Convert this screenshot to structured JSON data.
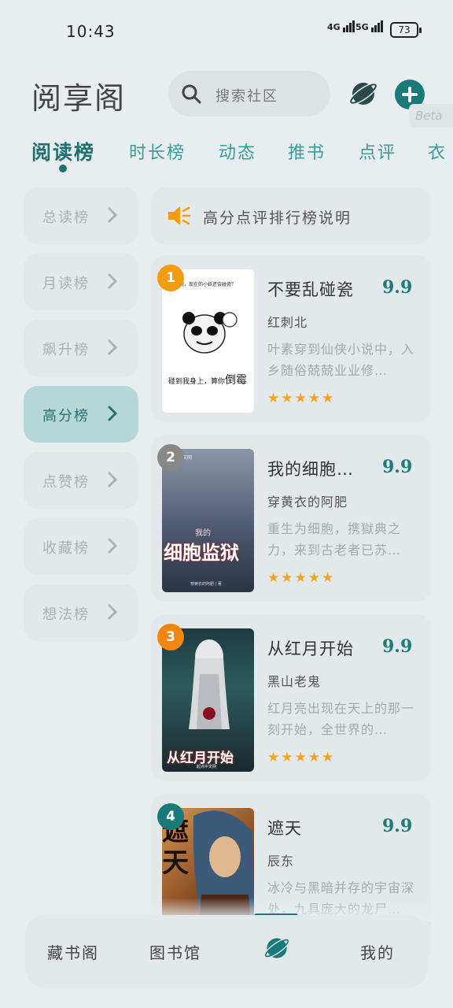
{
  "status_bar": {
    "time": "10:43",
    "net1": "4G",
    "net2": "5G",
    "battery": "73"
  },
  "header": {
    "title": "阅享阁",
    "search_placeholder": "搜索社区",
    "beta": "Beta"
  },
  "tabs": [
    "阅读榜",
    "时长榜",
    "动态",
    "推书",
    "点评",
    "衣"
  ],
  "sidebar": [
    {
      "label": "总读榜"
    },
    {
      "label": "月读榜"
    },
    {
      "label": "飙升榜"
    },
    {
      "label": "高分榜"
    },
    {
      "label": "点赞榜"
    },
    {
      "label": "收藏榜"
    },
    {
      "label": "想法榜"
    }
  ],
  "notice": "高分点评排行榜说明",
  "books": [
    {
      "rank": "1",
      "title": "不要乱碰瓷",
      "score": "9.9",
      "author": "红刺北",
      "desc": "叶素穿到仙侠小说中，入乡随俗兢兢业业修…",
      "cover_top": "这么多晚，现在的小妖还会碰瓷？",
      "cover_bottom1": "碰到我身上，算你",
      "cover_bottom2": "倒霉"
    },
    {
      "rank": "2",
      "title": "我的细胞…",
      "score": "9.9",
      "author": "穿黄衣的阿肥",
      "desc": "重生为细胞，携獄典之力，来到古老者已苏…",
      "cover_top": "起点中文网",
      "cover_mid": "我的",
      "cover_main": "细胞监狱",
      "cover_bottom": "穿黄衣的阿肥 | 著"
    },
    {
      "rank": "3",
      "title": "从红月开始",
      "score": "9.9",
      "author": "黑山老鬼",
      "desc": "红月亮出现在天上的那一刻开始，全世界的…",
      "cover_main": "从红月开始",
      "cover_bottom": "起点中文网"
    },
    {
      "rank": "4",
      "title": "遮天",
      "score": "9.9",
      "author": "辰东",
      "desc": "冰冷与黑暗并存的宇宙深处，九具庞大的龙尸…",
      "cover_main": "遮天"
    }
  ],
  "stars": "★★★★★",
  "bottom_nav": {
    "item1": "藏书阁",
    "item2": "图书馆",
    "item4": "我的"
  },
  "colors": {
    "accent": "#1f7a7a",
    "rank1": "#f39c12",
    "rank2": "#888888",
    "rank3": "#f0850f",
    "rank4": "#1a7a7a",
    "star": "#f2a51c"
  }
}
